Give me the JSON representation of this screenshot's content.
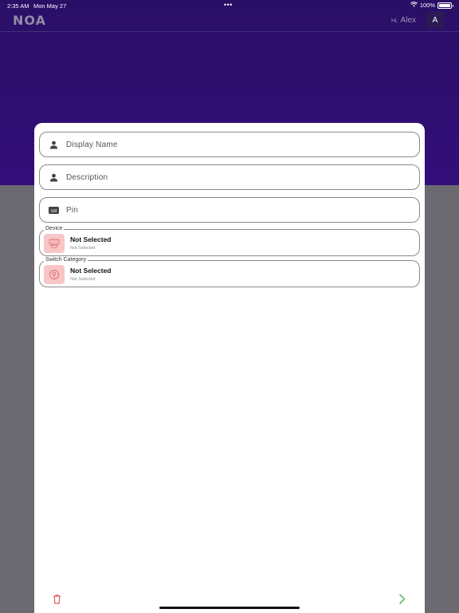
{
  "status_bar": {
    "time": "2:35 AM",
    "date": "Mon May 27",
    "dots": "•••",
    "battery_percent": "100%",
    "battery_level": 1.0
  },
  "header": {
    "logo": "NOA",
    "greeting_prefix": "Hi,",
    "user_name": "Alex",
    "avatar_initial": "A"
  },
  "form": {
    "fields": [
      {
        "label": "Display Name",
        "icon": "person-icon"
      },
      {
        "label": "Description",
        "icon": "person-icon"
      },
      {
        "label": "Pin",
        "icon": "numeric-icon",
        "icon_text": "123"
      }
    ],
    "selectors": [
      {
        "legend": "Device",
        "title": "Not Selected",
        "subtitle": "Not Selected",
        "icon": "device-icon"
      },
      {
        "legend": "Switch Category",
        "title": "Not Selected",
        "subtitle": "Not Selected",
        "icon": "category-icon"
      }
    ]
  },
  "colors": {
    "header_bg": "#2a0f66",
    "backdrop": "#6b6a70",
    "delete": "#e05a5a",
    "next": "#4caf50",
    "thumb_bg": "#f8c6c6"
  }
}
